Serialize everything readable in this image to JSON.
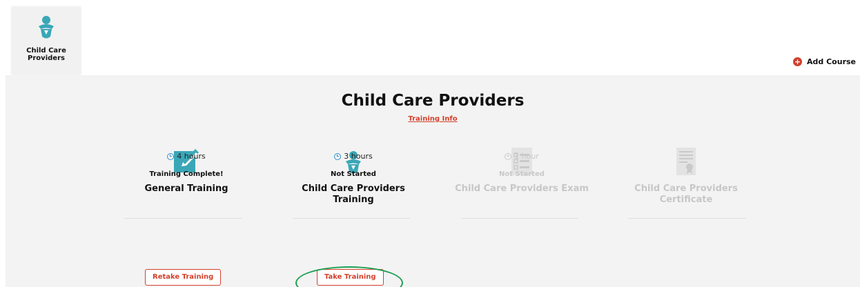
{
  "tabs": [
    {
      "label": "Child Care Providers",
      "icon": "baby-icon"
    }
  ],
  "add_course": {
    "label": "Add Course",
    "icon": "plus-circle-icon"
  },
  "panel": {
    "title": "Child Care Providers",
    "training_info_link": "Training Info"
  },
  "steps": [
    {
      "title": "General Training",
      "icon": "edit-icon",
      "duration": "4 hours",
      "status": "Training Complete!",
      "button": "Retake Training",
      "enabled": true
    },
    {
      "title": "Child Care Providers Training",
      "icon": "baby-icon",
      "duration": "3 hours",
      "status": "Not Started",
      "button": "Take Training",
      "enabled": true
    },
    {
      "title": "Child Care Providers Exam",
      "icon": "exam-list-icon",
      "duration": "1 hour",
      "status": "Not Started",
      "enabled": false
    },
    {
      "title": "Child Care Providers Certificate",
      "icon": "certificate-icon",
      "enabled": false
    }
  ],
  "colors": {
    "accent": "#d4402b",
    "icon_teal": "#3aa7b7",
    "clock_blue": "#2f90cf",
    "highlight": "#1aa052"
  }
}
